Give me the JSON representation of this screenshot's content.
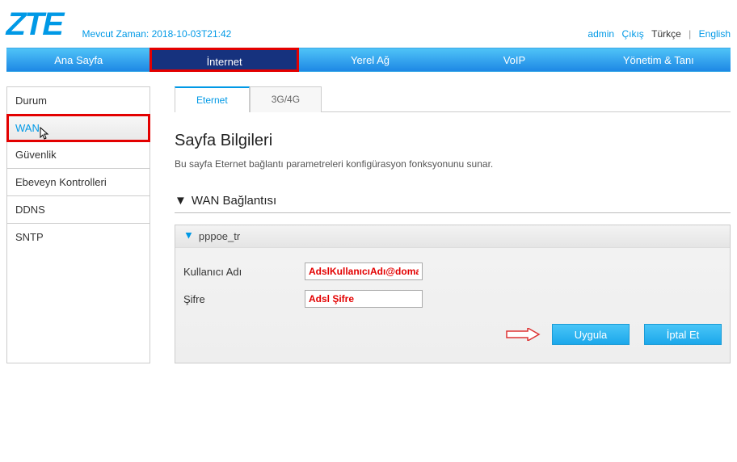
{
  "header": {
    "logo": "ZTE",
    "time_label": "Mevcut Zaman: 2018-10-03T21:42",
    "user": "admin",
    "logout": "Çıkış",
    "lang_tr": "Türkçe",
    "lang_en": "English"
  },
  "mainnav": {
    "home": "Ana Sayfa",
    "internet": "İnternet",
    "lan": "Yerel Ağ",
    "voip": "VoIP",
    "mgmt": "Yönetim & Tanı"
  },
  "sidebar": {
    "items": [
      {
        "key": "status",
        "label": "Durum"
      },
      {
        "key": "wan",
        "label": "WAN"
      },
      {
        "key": "security",
        "label": "Güvenlik"
      },
      {
        "key": "parental",
        "label": "Ebeveyn Kontrolleri"
      },
      {
        "key": "ddns",
        "label": "DDNS"
      },
      {
        "key": "sntp",
        "label": "SNTP"
      }
    ]
  },
  "tabs": {
    "ethernet": "Eternet",
    "3g4g": "3G/4G"
  },
  "page": {
    "title": "Sayfa Bilgileri",
    "desc": "Bu sayfa Eternet bağlantı parametreleri konfigürasyon fonksyonunu sunar.",
    "section_title": "WAN Bağlantısı",
    "conn_name": "pppoe_tr",
    "fields": {
      "user_label": "Kullanıcı Adı",
      "user_value": "AdslKullanıcıAdı@domain",
      "pass_label": "Şifre",
      "pass_value": "Adsl Şifre"
    },
    "buttons": {
      "apply": "Uygula",
      "cancel": "İptal Et"
    }
  }
}
